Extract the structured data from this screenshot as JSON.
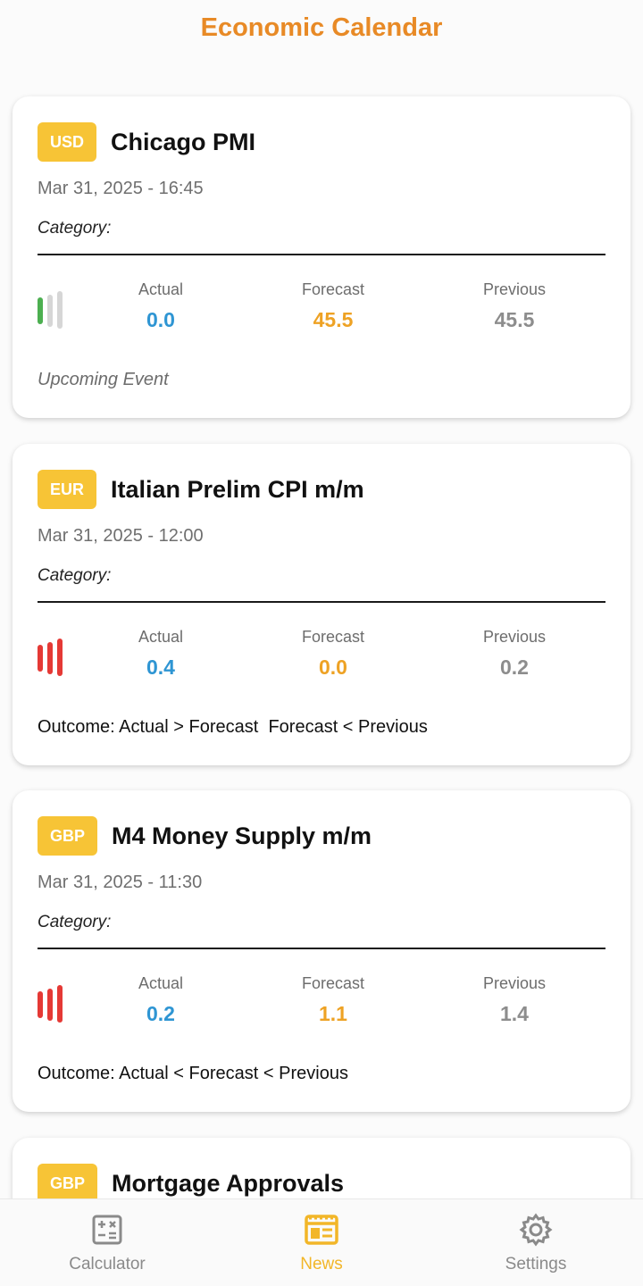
{
  "header": {
    "title": "Economic Calendar"
  },
  "labels": {
    "actual": "Actual",
    "forecast": "Forecast",
    "previous": "Previous"
  },
  "colors": {
    "accent_orange": "#e88a26",
    "badge_yellow": "#f7c436",
    "actual_blue": "#2e95d3",
    "forecast_orange": "#eea224",
    "previous_gray": "#8d8d8d",
    "impact_green": "#4caf50",
    "impact_red": "#e53935",
    "impact_inactive": "#d6d6d6"
  },
  "events": [
    {
      "currency": "USD",
      "title": "Chicago PMI",
      "datetime": "Mar 31, 2025 - 16:45",
      "category": "Category:",
      "impact": "low",
      "actual": "0.0",
      "forecast": "45.5",
      "previous": "45.5",
      "note": "Upcoming Event"
    },
    {
      "currency": "EUR",
      "title": "Italian Prelim CPI m/m",
      "datetime": "Mar 31, 2025 - 12:00",
      "category": "Category:",
      "impact": "high",
      "actual": "0.4",
      "forecast": "0.0",
      "previous": "0.2",
      "note": "Outcome: Actual > Forecast  Forecast < Previous"
    },
    {
      "currency": "GBP",
      "title": "M4 Money Supply m/m",
      "datetime": "Mar 31, 2025 - 11:30",
      "category": "Category:",
      "impact": "high",
      "actual": "0.2",
      "forecast": "1.1",
      "previous": "1.4",
      "note": "Outcome: Actual < Forecast < Previous"
    },
    {
      "currency": "GBP",
      "title": "Mortgage Approvals"
    }
  ],
  "nav": {
    "calculator": "Calculator",
    "news": "News",
    "settings": "Settings",
    "active": "news"
  }
}
